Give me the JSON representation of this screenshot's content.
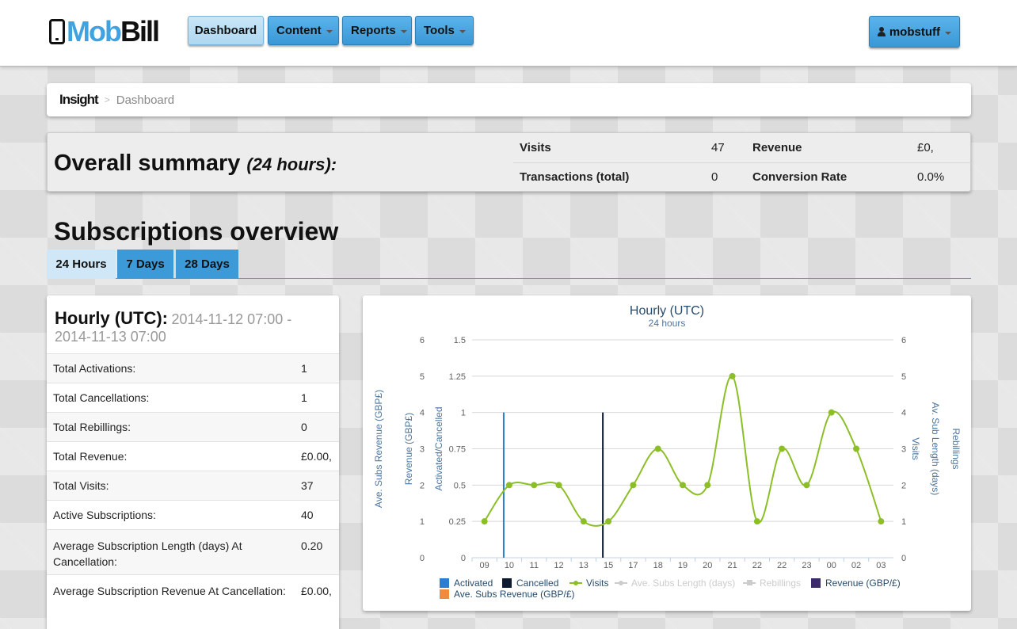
{
  "navbar": {
    "logo": {
      "part1": "Mob",
      "part2": "Bill"
    },
    "menu": [
      {
        "label": "Dashboard",
        "active": true,
        "dropdown": false
      },
      {
        "label": "Content",
        "active": false,
        "dropdown": true
      },
      {
        "label": "Reports",
        "active": false,
        "dropdown": true
      },
      {
        "label": "Tools",
        "active": false,
        "dropdown": true
      }
    ],
    "user": "mobstuff"
  },
  "breadcrumb": {
    "root": "Insight",
    "separator": ">",
    "current": "Dashboard"
  },
  "summary": {
    "title": "Overall summary",
    "period": "(24 hours):",
    "visits_label": "Visits",
    "visits_value": "47",
    "revenue_label": "Revenue",
    "revenue_value": "£0,",
    "transactions_label": "Transactions (total)",
    "transactions_value": "0",
    "conversion_label": "Conversion Rate",
    "conversion_value": "0.0%"
  },
  "subscriptions": {
    "title": "Subscriptions overview",
    "tabs": [
      "24 Hours",
      "7 Days",
      "28 Days"
    ],
    "active_tab": "24 Hours"
  },
  "stats": {
    "heading": "Hourly (UTC):",
    "range": "2014-11-12 07:00 - 2014-11-13 07:00",
    "rows": [
      {
        "label": "Total Activations:",
        "value": "1"
      },
      {
        "label": "Total Cancellations:",
        "value": "1"
      },
      {
        "label": "Total Rebillings:",
        "value": "0"
      },
      {
        "label": "Total Revenue:",
        "value": "£0.00,"
      },
      {
        "label": "Total Visits:",
        "value": "37"
      },
      {
        "label": "Active Subscriptions:",
        "value": "40"
      },
      {
        "label": "Average Subscription Length (days) At Cancellation:",
        "value": "0.20"
      },
      {
        "label": "Average Subscription Revenue At Cancellation:",
        "value": "£0.00,"
      }
    ]
  },
  "colors": {
    "accent_blue": "#3c9ad8",
    "activated": "#2a7fd4",
    "cancelled": "#0b1a2e",
    "visits": "#8cbf26",
    "revenue": "#3b2b6b",
    "ave_subs_revenue": "#f08a3c",
    "disabled": "#cccccc"
  },
  "chart_data": {
    "type": "line",
    "title": "Hourly (UTC)",
    "subtitle": "24 hours",
    "categories": [
      "09",
      "10",
      "11",
      "12",
      "13",
      "15",
      "17",
      "18",
      "19",
      "20",
      "21",
      "22",
      "22",
      "23",
      "00",
      "02",
      "03"
    ],
    "y_axes": [
      {
        "label": "Ave. Subs Revenue (GBP£)",
        "ticks": [
          "0",
          "1",
          "2",
          "3",
          "4",
          "5",
          "6"
        ],
        "side": "left"
      },
      {
        "label": "Revenue (GBP£)",
        "ticks": [],
        "side": "left"
      },
      {
        "label": "Activated/Cancelled",
        "ticks": [
          "0",
          "0.25",
          "0.5",
          "0.75",
          "1",
          "1.25",
          "1.5"
        ],
        "ylim": [
          0,
          1.5
        ],
        "side": "left"
      },
      {
        "label": "Visits",
        "ticks": [
          "0",
          "1",
          "2",
          "3",
          "4",
          "5",
          "6"
        ],
        "ylim": [
          0,
          6
        ],
        "side": "right"
      },
      {
        "label": "Av. Sub Length (days)",
        "ticks": [],
        "side": "right"
      },
      {
        "label": "Rebillings",
        "ticks": [],
        "side": "right"
      }
    ],
    "series": [
      {
        "name": "Activated",
        "type": "bar",
        "axis": "Activated/Cancelled",
        "values": [
          0,
          1,
          0,
          0,
          0,
          0,
          0,
          0,
          0,
          0,
          0,
          0,
          0,
          0,
          0,
          0,
          0
        ]
      },
      {
        "name": "Cancelled",
        "type": "bar",
        "axis": "Activated/Cancelled",
        "values": [
          0,
          0,
          0,
          0,
          0,
          1,
          0,
          0,
          0,
          0,
          0,
          0,
          0,
          0,
          0,
          0,
          0
        ]
      },
      {
        "name": "Visits",
        "type": "spline",
        "axis": "Visits",
        "values": [
          1,
          2,
          2,
          2,
          1,
          1,
          2,
          3,
          2,
          2,
          5,
          1,
          3,
          2,
          4,
          3,
          1
        ]
      },
      {
        "name": "Ave. Subs Length (days)",
        "type": "line",
        "hidden": true
      },
      {
        "name": "Rebillings",
        "type": "line",
        "hidden": true
      },
      {
        "name": "Revenue (GBP/£)",
        "type": "bar"
      },
      {
        "name": "Ave. Subs Revenue (GBP/£)",
        "type": "bar"
      }
    ],
    "grid": true,
    "legend_position": "bottom"
  }
}
